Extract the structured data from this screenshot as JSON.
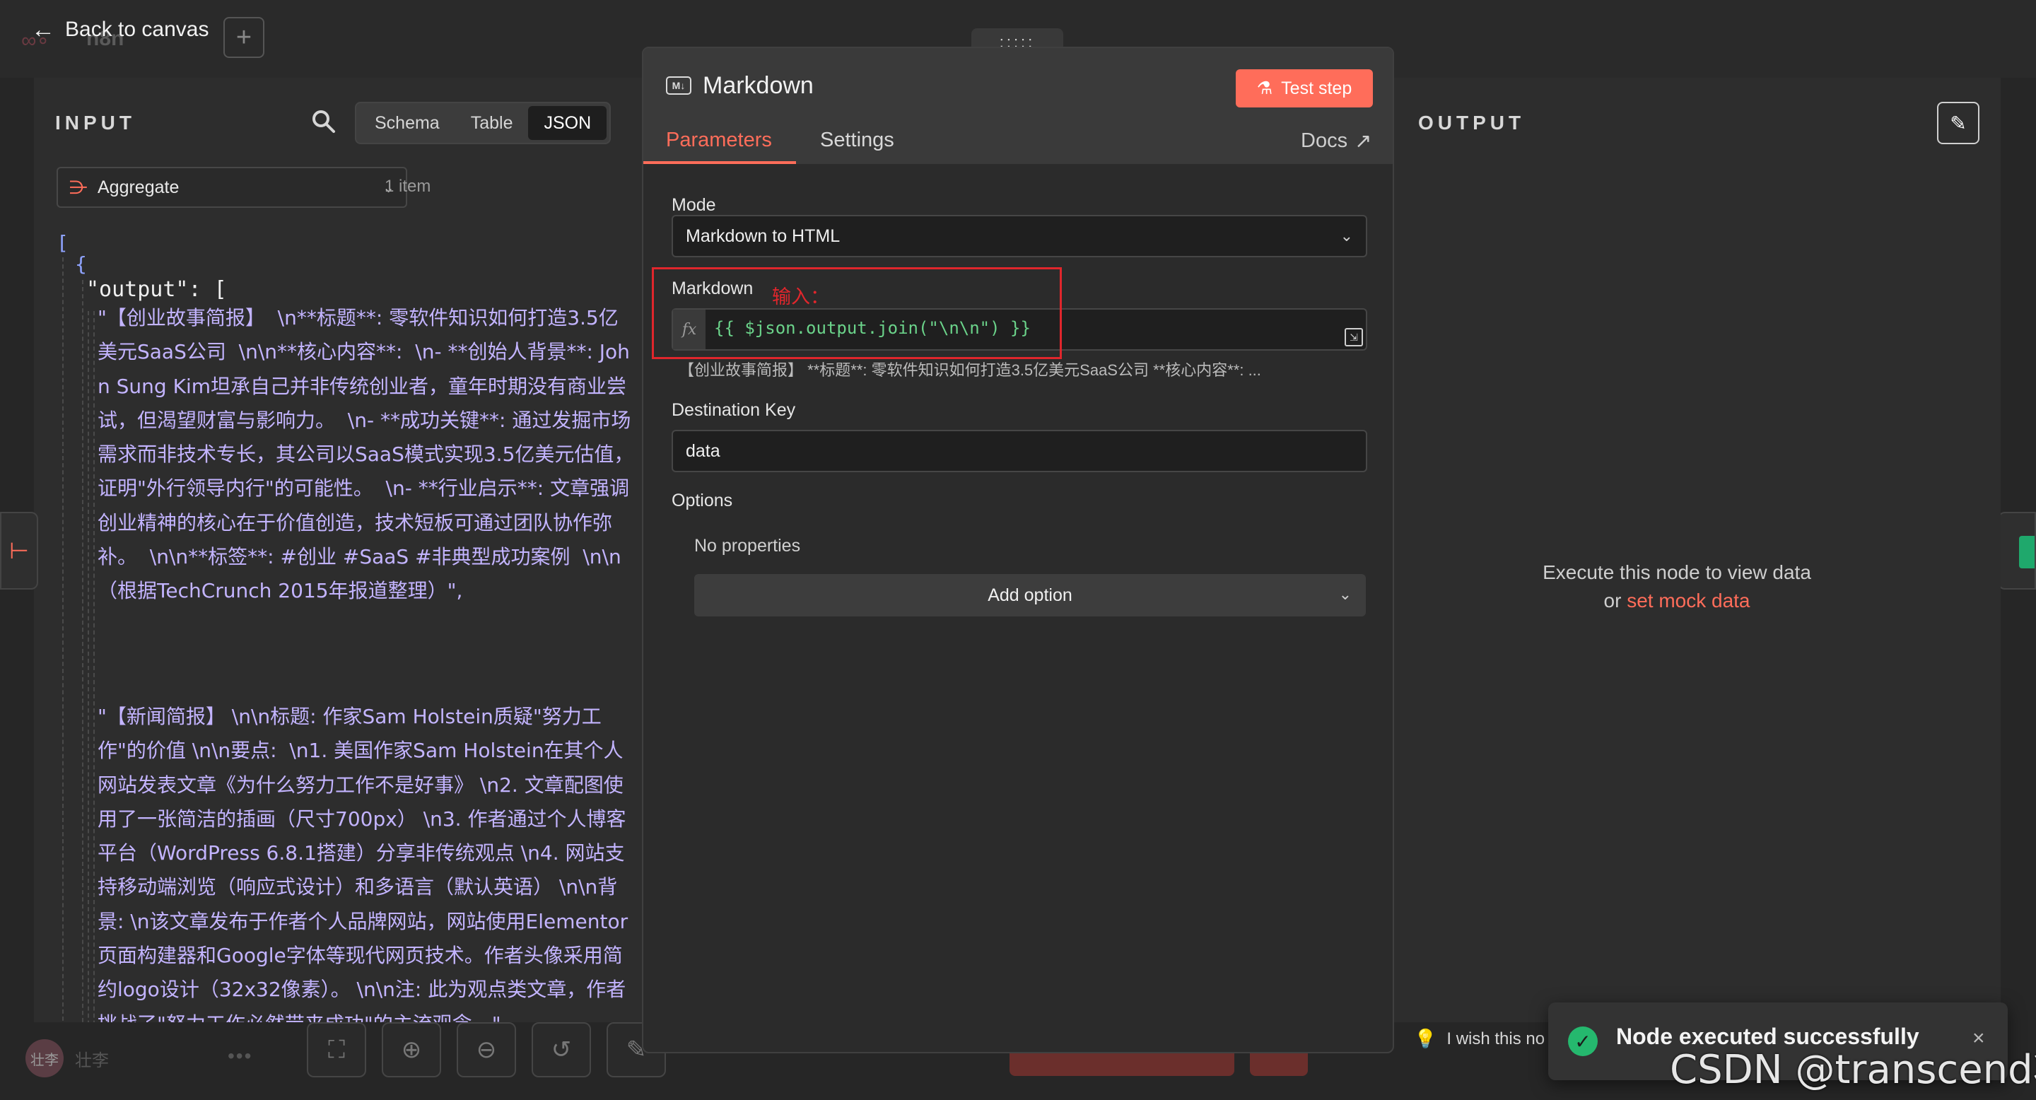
{
  "topbar": {
    "back_label": "Back to canvas",
    "workflow_name_ghost": "n8n"
  },
  "input_panel": {
    "title": "INPUT",
    "view_tabs": [
      "Schema",
      "Table",
      "JSON"
    ],
    "active_view": "JSON",
    "node_selector": "Aggregate",
    "item_count": "1 item",
    "json": {
      "open_bracket": "[",
      "open_brace": "{",
      "key_line": "\"output\": [",
      "strings": [
        "\"【创业故事简报】  \\n**标题**: 零软件知识如何打造3.5亿美元SaaS公司  \\n\\n**核心内容**:  \\n- **创始人背景**: John Sung Kim坦承自己并非传统创业者，童年时期没有商业尝试，但渴望财富与影响力。  \\n- **成功关键**: 通过发掘市场需求而非技术专长，其公司以SaaS模式实现3.5亿美元估值，证明\"外行领导内行\"的可能性。  \\n- **行业启示**: 文章强调创业精神的核心在于价值创造，技术短板可通过团队协作弥补。  \\n\\n**标签**: #创业 #SaaS #非典型成功案例  \\n\\n（根据TechCrunch 2015年报道整理）\",",
        "\"【新闻简报】 \\n\\n标题: 作家Sam Holstein质疑\"努力工作\"的价值 \\n\\n要点:  \\n1. 美国作家Sam Holstein在其个人网站发表文章《为什么努力工作不是好事》 \\n2. 文章配图使用了一张简洁的插画（尺寸700px） \\n3. 作者通过个人博客平台（WordPress 6.8.1搭建）分享非传统观点 \\n4. 网站支持移动端浏览（响应式设计）和多语言（默认英语） \\n\\n背景: \\n该文章发布于作者个人品牌网站，网站使用Elementor页面构建器和Google字体等现代网页技术。作者头像采用简约logo设计（32x32像素）。 \\n\\n注: 此为观点类文章，作者挑战了\"努力工作必然带来成功\"的主流观念。\""
      ]
    }
  },
  "bottom_left": {
    "user_name": "壮李",
    "avatar_text": "壮李"
  },
  "modal": {
    "drag_handle": ":::::",
    "title": "Markdown",
    "test_button": "Test step",
    "tabs": [
      "Parameters",
      "Settings"
    ],
    "docs_label": "Docs",
    "mode": {
      "label": "Mode",
      "value": "Markdown to HTML"
    },
    "markdown": {
      "label": "Markdown",
      "expression": "{{ $json.output.join(\"\\n\\n\") }}",
      "preview": "【创业故事简报】   **标题**: 零软件知识如何打造3.5亿美元SaaS公司   **核心内容**:   ..."
    },
    "destination_key": {
      "label": "Destination Key",
      "value": "data"
    },
    "options": {
      "label": "Options",
      "empty_text": "No properties",
      "add_button": "Add option"
    }
  },
  "annotation": {
    "label": "输入："
  },
  "output_panel": {
    "title": "OUTPUT",
    "message_line1": "Execute this node to view data",
    "message_or": "or ",
    "mock_link": "set mock data"
  },
  "hint": {
    "text": "I wish this no"
  },
  "toast": {
    "message": "Node executed successfully",
    "close": "×"
  },
  "watermark": "CSDN @transcend壮",
  "colors": {
    "accent": "#ff6d5a",
    "success": "#25b86e",
    "annotation_red": "#e0262c",
    "expression_green": "#6bd38a",
    "json_string": "#c3b4ff"
  }
}
